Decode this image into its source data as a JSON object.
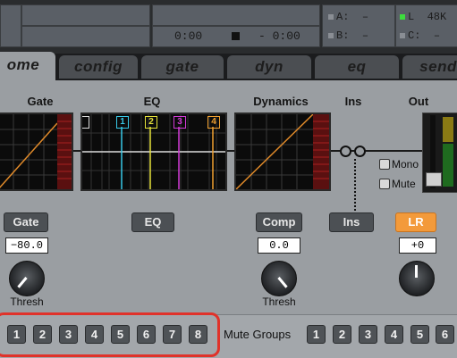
{
  "transport": {
    "time_elapsed": "0:00",
    "time_remaining": "- 0:00",
    "stop_icon": "stop-icon"
  },
  "channels": {
    "a": {
      "label": "A:",
      "value": "–"
    },
    "b": {
      "label": "B:",
      "value": "–"
    },
    "l": {
      "label": "L",
      "value": "48K"
    },
    "c": {
      "label": "C:",
      "value": "–"
    }
  },
  "tabs": [
    "ome",
    "config",
    "gate",
    "dyn",
    "eq",
    "send"
  ],
  "sections": {
    "gate": "Gate",
    "eq": "EQ",
    "dynamics": "Dynamics",
    "ins": "Ins",
    "out": "Out"
  },
  "eq_bands": [
    "1",
    "2",
    "3",
    "4"
  ],
  "eq_band_colors": [
    "#38c8e6",
    "#e6e23a",
    "#d23ad6",
    "#f0a030"
  ],
  "buttons": {
    "gate": "Gate",
    "eq": "EQ",
    "comp": "Comp",
    "ins": "Ins",
    "lr": "LR"
  },
  "values": {
    "gate": "−80.0",
    "comp": "0.0",
    "out": "+0"
  },
  "knob_labels": {
    "gate": "Thresh",
    "comp": "Thresh"
  },
  "checkboxes": {
    "mono": "Mono",
    "mute": "Mute"
  },
  "dca_buttons": [
    "1",
    "2",
    "3",
    "4",
    "5",
    "6",
    "7",
    "8"
  ],
  "mute_groups": {
    "label": "Mute Groups",
    "buttons": [
      "1",
      "2",
      "3",
      "4",
      "5",
      "6"
    ]
  },
  "colors": {
    "accent_orange": "#f39a3a",
    "highlight_red": "#e0322a",
    "meter_green": "#3ddc3d"
  }
}
